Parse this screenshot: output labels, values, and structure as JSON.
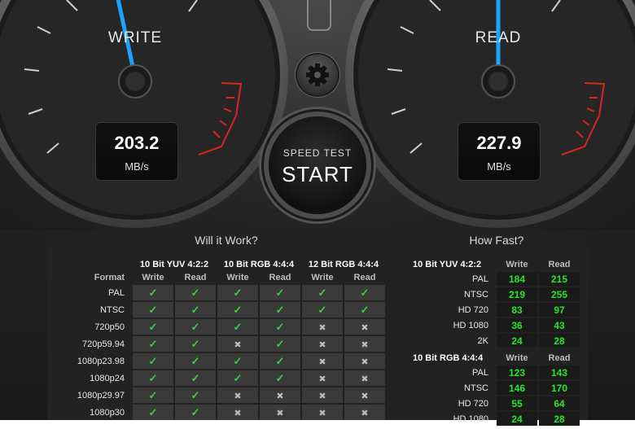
{
  "gauges": {
    "write": {
      "label": "WRITE",
      "value": "203.2",
      "unit": "MB/s"
    },
    "read": {
      "label": "READ",
      "value": "227.9",
      "unit": "MB/s"
    }
  },
  "start_button": {
    "subtitle": "SPEED TEST",
    "label": "START"
  },
  "settings_icon": "gear-icon",
  "will_it_work": {
    "title": "Will it Work?",
    "row_header": "Format",
    "groups": [
      "10 Bit YUV 4:2:2",
      "10 Bit RGB 4:4:4",
      "12 Bit RGB 4:4:4"
    ],
    "sub_headers": [
      "Write",
      "Read"
    ],
    "rows": [
      {
        "format": "PAL",
        "marks": [
          "ok",
          "ok",
          "ok",
          "ok",
          "ok",
          "ok"
        ]
      },
      {
        "format": "NTSC",
        "marks": [
          "ok",
          "ok",
          "ok",
          "ok",
          "ok",
          "ok"
        ]
      },
      {
        "format": "720p50",
        "marks": [
          "ok",
          "ok",
          "ok",
          "ok",
          "no",
          "no"
        ]
      },
      {
        "format": "720p59.94",
        "marks": [
          "ok",
          "ok",
          "no",
          "ok",
          "no",
          "no"
        ]
      },
      {
        "format": "1080p23.98",
        "marks": [
          "ok",
          "ok",
          "ok",
          "ok",
          "no",
          "no"
        ]
      },
      {
        "format": "1080p24",
        "marks": [
          "ok",
          "ok",
          "ok",
          "ok",
          "no",
          "no"
        ]
      },
      {
        "format": "1080p29.97",
        "marks": [
          "ok",
          "ok",
          "no",
          "no",
          "no",
          "no"
        ]
      },
      {
        "format": "1080p30",
        "marks": [
          "ok",
          "ok",
          "no",
          "no",
          "no",
          "no"
        ]
      }
    ]
  },
  "how_fast": {
    "title": "How Fast?",
    "sections": [
      {
        "group": "10 Bit YUV 4:2:2",
        "sub_headers": [
          "Write",
          "Read"
        ],
        "rows": [
          {
            "format": "PAL",
            "write": "184",
            "read": "215"
          },
          {
            "format": "NTSC",
            "write": "219",
            "read": "255"
          },
          {
            "format": "HD 720",
            "write": "83",
            "read": "97"
          },
          {
            "format": "HD 1080",
            "write": "36",
            "read": "43"
          },
          {
            "format": "2K",
            "write": "24",
            "read": "28"
          }
        ]
      },
      {
        "group": "10 Bit RGB 4:4:4",
        "sub_headers": [
          "Write",
          "Read"
        ],
        "rows": [
          {
            "format": "PAL",
            "write": "123",
            "read": "143"
          },
          {
            "format": "NTSC",
            "write": "146",
            "read": "170"
          },
          {
            "format": "HD 720",
            "write": "55",
            "read": "64"
          },
          {
            "format": "HD 1080",
            "write": "24",
            "read": "28"
          }
        ]
      }
    ]
  },
  "colors": {
    "needle": "#1aa3ff",
    "redline": "#d8261c",
    "ok": "#3bd13b",
    "speed_value": "#26e626"
  }
}
